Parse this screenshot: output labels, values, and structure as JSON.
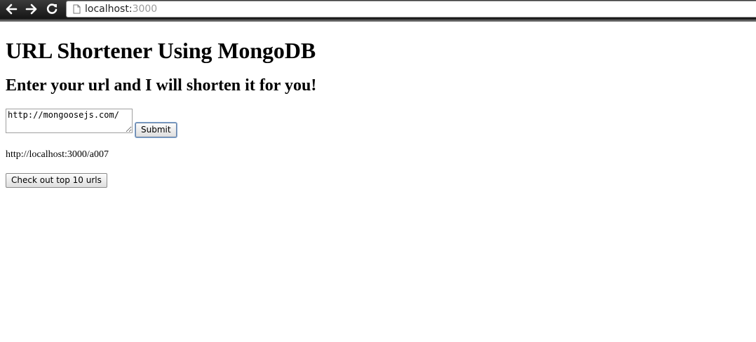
{
  "browser": {
    "url_host": "localhost:",
    "url_port": "3000",
    "icons": {
      "back": "back-arrow-icon",
      "forward": "forward-arrow-icon",
      "reload": "reload-icon",
      "page": "page-icon"
    }
  },
  "page": {
    "title": "URL Shortener Using MongoDB",
    "subtitle": "Enter your url and I will shorten it for you!",
    "url_input_value": "http://mongoosejs.com/",
    "submit_label": "Submit",
    "short_url": "http://localhost:3000/a007",
    "top10_label": "Check out top 10 urls"
  },
  "colors": {
    "focus_ring": "#7da2ce",
    "toolbar": "#1e1e1e"
  }
}
